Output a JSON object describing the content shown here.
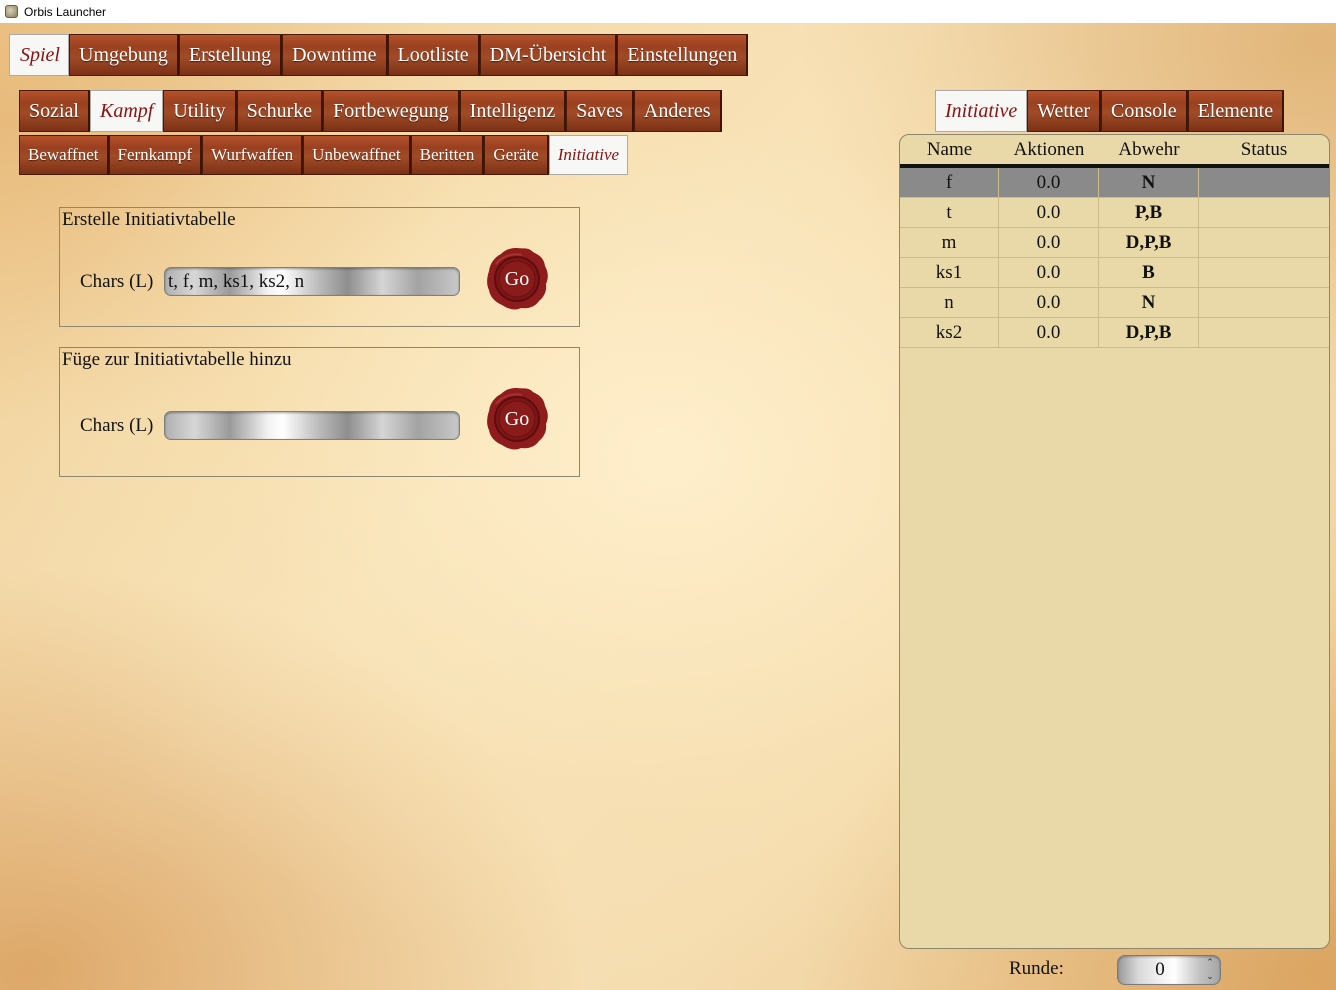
{
  "window": {
    "title": "Orbis Launcher"
  },
  "main_tabs": [
    "Spiel",
    "Umgebung",
    "Erstellung",
    "Downtime",
    "Lootliste",
    "DM-Übersicht",
    "Einstellungen"
  ],
  "category_tabs": [
    "Sozial",
    "Kampf",
    "Utility",
    "Schurke",
    "Fortbewegung",
    "Intelligenz",
    "Saves",
    "Anderes"
  ],
  "combat_tabs": [
    "Bewaffnet",
    "Fernkampf",
    "Wurfwaffen",
    "Unbewaffnet",
    "Beritten",
    "Geräte",
    "Initiative"
  ],
  "right_tabs": [
    "Initiative",
    "Wetter",
    "Console",
    "Elemente"
  ],
  "create_group": {
    "title": "Erstelle Initiativtabelle",
    "chars_label": "Chars (L)",
    "chars_value": "t, f, m, ks1, ks2, n",
    "go_label": "Go"
  },
  "add_group": {
    "title": "Füge zur Initiativtabelle hinzu",
    "chars_label": "Chars (L)",
    "chars_value": "",
    "go_label": "Go"
  },
  "initiative_table": {
    "columns": [
      "Name",
      "Aktionen",
      "Abwehr",
      "Status"
    ],
    "rows": [
      {
        "name": "f",
        "aktionen": "0.0",
        "abwehr": "N",
        "status": ""
      },
      {
        "name": "t",
        "aktionen": "0.0",
        "abwehr": "P,B",
        "status": ""
      },
      {
        "name": "m",
        "aktionen": "0.0",
        "abwehr": "D,P,B",
        "status": ""
      },
      {
        "name": "ks1",
        "aktionen": "0.0",
        "abwehr": "B",
        "status": ""
      },
      {
        "name": "n",
        "aktionen": "0.0",
        "abwehr": "N",
        "status": ""
      },
      {
        "name": "ks2",
        "aktionen": "0.0",
        "abwehr": "D,P,B",
        "status": ""
      }
    ]
  },
  "round": {
    "label": "Runde:",
    "value": "0"
  },
  "colors": {
    "tab_wood": "#9a4020",
    "tab_active_text": "#8b1111",
    "table_bg": "#e9d9a8",
    "selected_row": "#8a8a8a",
    "wax_seal": "#8e1c1c"
  }
}
